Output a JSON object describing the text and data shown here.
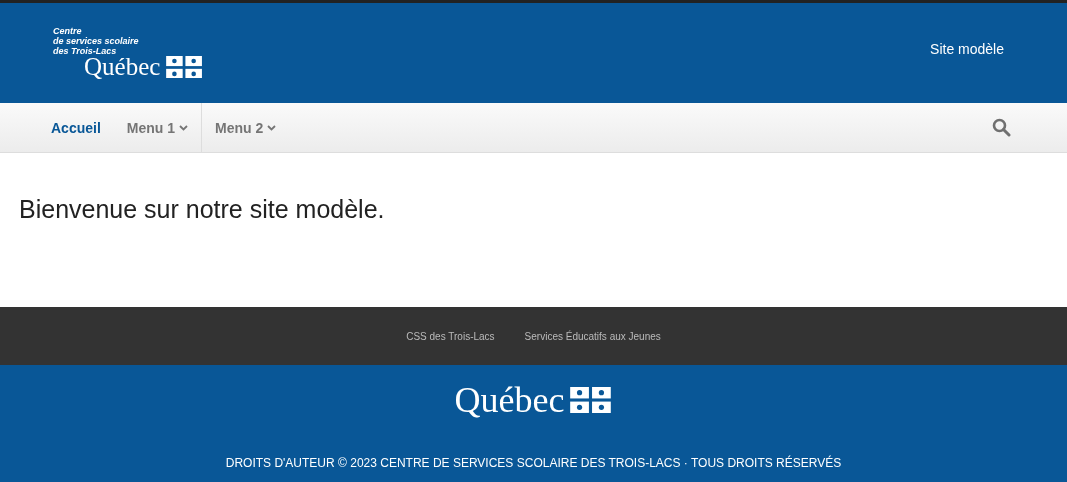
{
  "header": {
    "logo": {
      "org_lines": [
        "Centre",
        "de services scolaire",
        "des Trois-Lacs"
      ],
      "wordmark": "Québec"
    },
    "site_title": "Site modèle"
  },
  "nav": {
    "items": [
      {
        "label": "Accueil",
        "selected": true,
        "kind": "link"
      },
      {
        "label": "Menu 1",
        "selected": false,
        "kind": "dropdown"
      },
      {
        "label": "Menu 2",
        "selected": false,
        "kind": "dropdown"
      }
    ]
  },
  "content": {
    "heading": "Bienvenue sur notre site modèle."
  },
  "footer": {
    "links": [
      "CSS des Trois-Lacs",
      "Services Éducatifs aux Jeunes"
    ],
    "wordmark": "Québec",
    "copyright": "DROITS D'AUTEUR © 2023 CENTRE DE SERVICES SCOLAIRE DES TROIS-LACS · TOUS DROITS RÉSERVÉS"
  }
}
